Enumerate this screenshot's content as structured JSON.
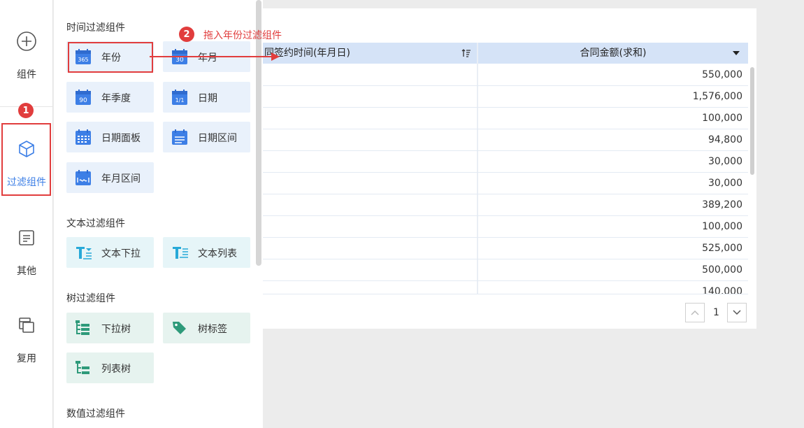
{
  "rail": {
    "items": [
      {
        "label": "组件",
        "icon": "plus-circle-icon"
      },
      {
        "label": "过滤组件",
        "icon": "cube-icon"
      },
      {
        "label": "其他",
        "icon": "document-icon"
      },
      {
        "label": "复用",
        "icon": "copy-icon"
      }
    ]
  },
  "panel": {
    "sections": [
      {
        "title": "时间过滤组件"
      },
      {
        "title": "文本过滤组件"
      },
      {
        "title": "树过滤组件"
      },
      {
        "title": "数值过滤组件"
      }
    ],
    "time_items": [
      "年份",
      "年月",
      "年季度",
      "日期",
      "日期面板",
      "日期区间",
      "年月区间"
    ],
    "time_icon_text": {
      "year": "365",
      "month": "30",
      "quarter": "90",
      "date": "1/1"
    },
    "text_items": [
      "文本下拉",
      "文本列表"
    ],
    "tree_items": [
      "下拉树",
      "树标签",
      "列表树"
    ]
  },
  "annotations": {
    "step1": "1",
    "step2": "2",
    "step2_text": "拖入年份过滤组件"
  },
  "table": {
    "col1_header": "同签约时间(年月日)",
    "col2_header": "合同金额(求和)",
    "values": [
      "550,000",
      "1,576,000",
      "100,000",
      "94,800",
      "30,000",
      "30,000",
      "389,200",
      "100,000",
      "525,000",
      "500,000",
      "140,000"
    ]
  },
  "pager": {
    "page": "1"
  },
  "colors": {
    "accent": "#3d7fe6",
    "highlight": "#e13d3d",
    "header": "#d5e3f7"
  }
}
